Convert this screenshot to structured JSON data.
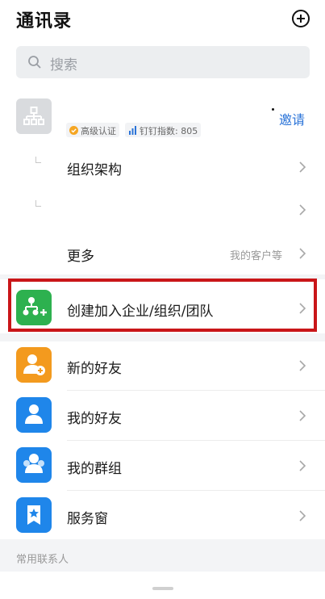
{
  "header": {
    "title": "通讯录"
  },
  "search": {
    "placeholder": "搜索"
  },
  "org": {
    "badge_cert": "高级认证",
    "badge_index": "钉钉指数: 805",
    "invite_label": "邀请",
    "items": [
      {
        "label": "组织架构",
        "hint": ""
      },
      {
        "label": "",
        "hint": ""
      },
      {
        "label": "更多",
        "hint": "我的客户等"
      }
    ]
  },
  "create_team": {
    "label": "创建加入企业/组织/团队"
  },
  "contacts": [
    {
      "label": "新的好友",
      "icon": "user-add-icon",
      "color": "#f39a1e"
    },
    {
      "label": "我的好友",
      "icon": "user-icon",
      "color": "#1f86ea"
    },
    {
      "label": "我的群组",
      "icon": "group-icon",
      "color": "#1f86ea"
    },
    {
      "label": "服务窗",
      "icon": "service-window-icon",
      "color": "#1f86ea"
    }
  ],
  "section": {
    "frequent_contacts": "常用联系人"
  },
  "colors": {
    "accent": "#2a73d8",
    "green": "#2db14f",
    "highlight_border": "#c91619"
  }
}
